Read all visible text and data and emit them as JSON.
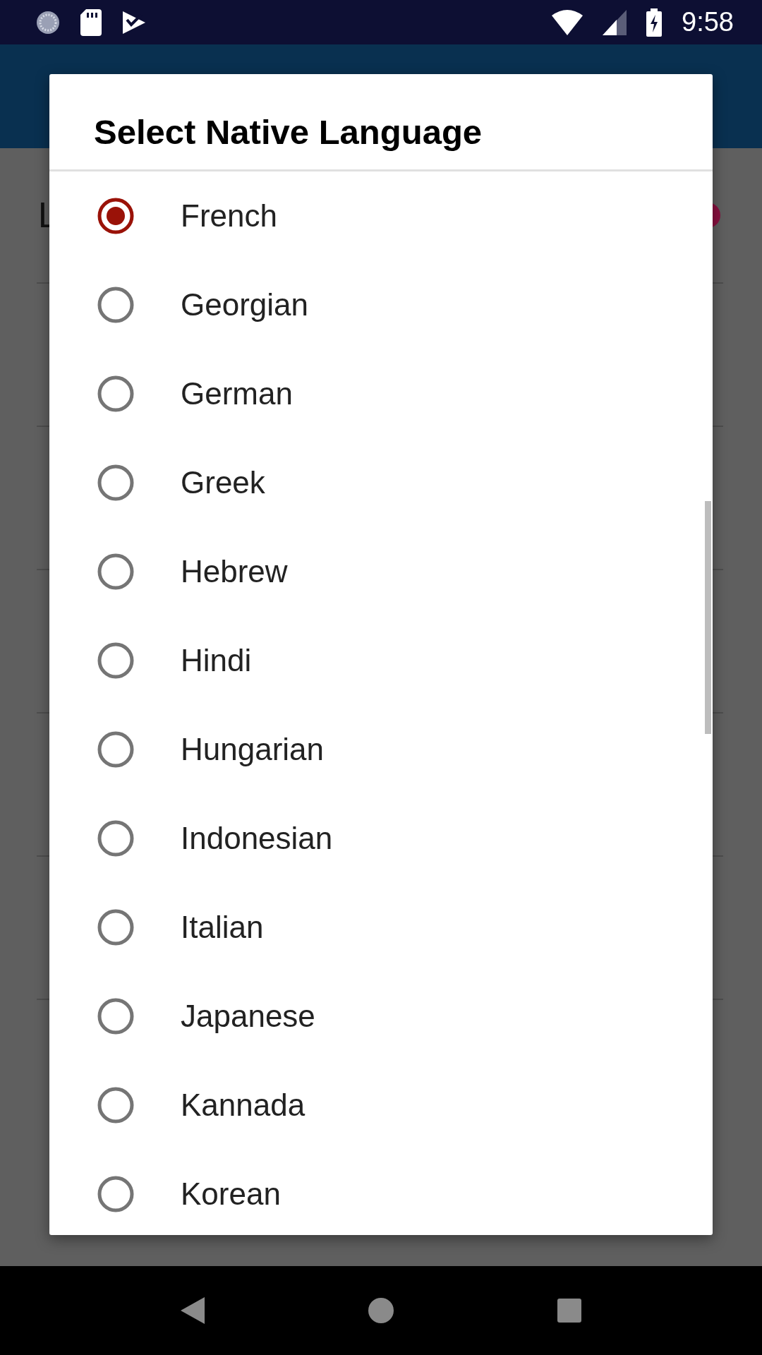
{
  "status_bar": {
    "time": "9:58"
  },
  "background": {
    "first_row_label": "L"
  },
  "dialog": {
    "title": "Select Native Language",
    "options": [
      {
        "label": "French",
        "selected": true
      },
      {
        "label": "Georgian",
        "selected": false
      },
      {
        "label": "German",
        "selected": false
      },
      {
        "label": "Greek",
        "selected": false
      },
      {
        "label": "Hebrew",
        "selected": false
      },
      {
        "label": "Hindi",
        "selected": false
      },
      {
        "label": "Hungarian",
        "selected": false
      },
      {
        "label": "Indonesian",
        "selected": false
      },
      {
        "label": "Italian",
        "selected": false
      },
      {
        "label": "Japanese",
        "selected": false
      },
      {
        "label": "Kannada",
        "selected": false
      },
      {
        "label": "Korean",
        "selected": false
      }
    ]
  }
}
